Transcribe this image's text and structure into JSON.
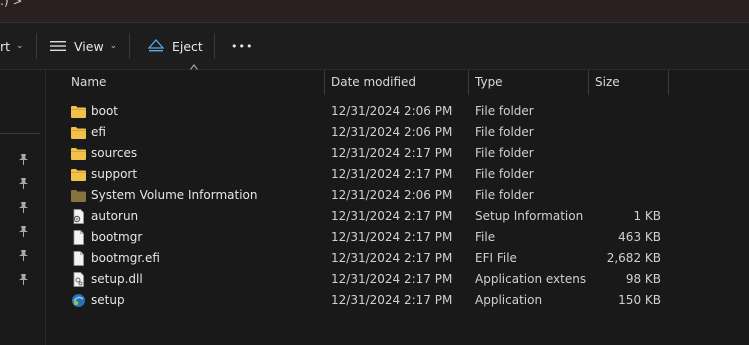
{
  "titlebar": {
    "crumbs": ":) >"
  },
  "toolbar": {
    "sort_label": "rt",
    "view_label": "View",
    "eject_label": "Eject",
    "more_label": "•••"
  },
  "columns": {
    "name": "Name",
    "date": "Date modified",
    "type": "Type",
    "size": "Size"
  },
  "files": [
    {
      "name": "boot",
      "date": "12/31/2024 2:06 PM",
      "type": "File folder",
      "size": "",
      "icon": "folder-icon"
    },
    {
      "name": "efi",
      "date": "12/31/2024 2:06 PM",
      "type": "File folder",
      "size": "",
      "icon": "folder-icon"
    },
    {
      "name": "sources",
      "date": "12/31/2024 2:17 PM",
      "type": "File folder",
      "size": "",
      "icon": "folder-icon"
    },
    {
      "name": "support",
      "date": "12/31/2024 2:17 PM",
      "type": "File folder",
      "size": "",
      "icon": "folder-icon"
    },
    {
      "name": "System Volume Information",
      "date": "12/31/2024 2:06 PM",
      "type": "File folder",
      "size": "",
      "icon": "folder-dim-icon"
    },
    {
      "name": "autorun",
      "date": "12/31/2024 2:17 PM",
      "type": "Setup Information",
      "size": "1 KB",
      "icon": "setup-info-icon"
    },
    {
      "name": "bootmgr",
      "date": "12/31/2024 2:17 PM",
      "type": "File",
      "size": "463 KB",
      "icon": "file-icon"
    },
    {
      "name": "bootmgr.efi",
      "date": "12/31/2024 2:17 PM",
      "type": "EFI File",
      "size": "2,682 KB",
      "icon": "file-icon"
    },
    {
      "name": "setup.dll",
      "date": "12/31/2024 2:17 PM",
      "type": "Application extens...",
      "size": "98 KB",
      "icon": "dll-icon"
    },
    {
      "name": "setup",
      "date": "12/31/2024 2:17 PM",
      "type": "Application",
      "size": "150 KB",
      "icon": "app-icon"
    }
  ],
  "colors": {
    "folder": "#f0c14b",
    "folder_dim": "#8a7140",
    "accent_eject": "#5aa8e6"
  }
}
